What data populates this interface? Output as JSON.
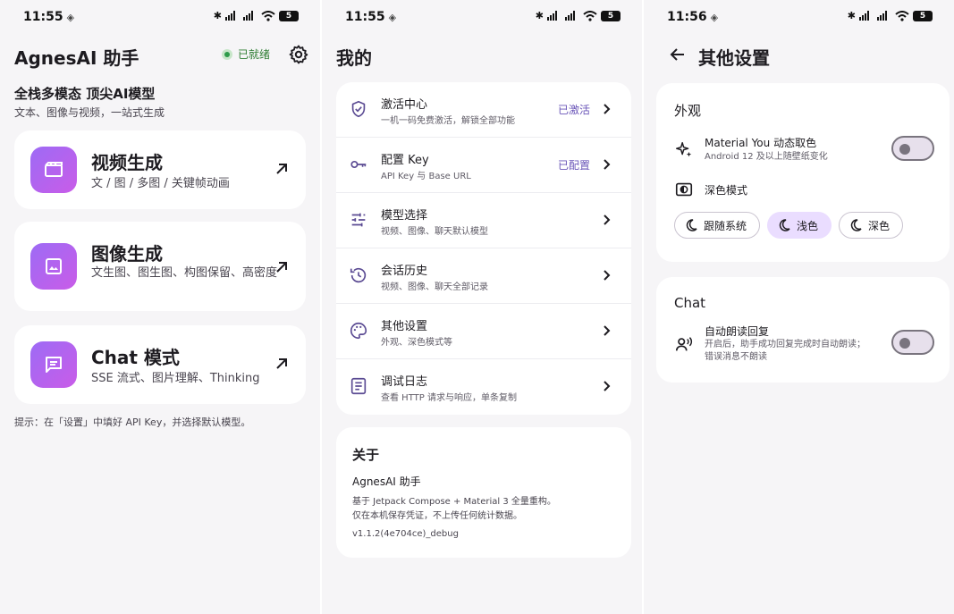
{
  "status_bars": [
    {
      "time": "11:55",
      "battery": "5"
    },
    {
      "time": "11:55",
      "battery": "5"
    },
    {
      "time": "11:56",
      "battery": "5"
    }
  ],
  "home": {
    "title": "AgnesAI 助手",
    "ready_label": "已就绪",
    "hero_title": "全栈多模态 顶尖AI模型",
    "hero_sub": "文本、图像与视频，一站式生成",
    "cards": [
      {
        "title": "视频生成",
        "sub": "文 / 图 / 多图 / 关键帧动画",
        "icon": "video-clapper-icon"
      },
      {
        "title": "图像生成",
        "sub": "文生图、图生图、构图保留、高密度",
        "icon": "image-icon"
      },
      {
        "title": "Chat 模式",
        "sub": "SSE 流式、图片理解、Thinking",
        "icon": "chat-icon"
      }
    ],
    "tip": "提示：在「设置」中填好 API Key，并选择默认模型。"
  },
  "mine": {
    "title": "我的",
    "items": [
      {
        "title": "激活中心",
        "sub": "一机一码免费激活，解锁全部功能",
        "status": "已激活",
        "icon": "shield-icon"
      },
      {
        "title": "配置 Key",
        "sub": "API Key 与 Base URL",
        "status": "已配置",
        "icon": "key-icon"
      },
      {
        "title": "模型选择",
        "sub": "视频、图像、聊天默认模型",
        "status": "",
        "icon": "tune-icon"
      },
      {
        "title": "会话历史",
        "sub": "视频、图像、聊天全部记录",
        "status": "",
        "icon": "history-icon"
      },
      {
        "title": "其他设置",
        "sub": "外观、深色模式等",
        "status": "",
        "icon": "palette-icon"
      },
      {
        "title": "调试日志",
        "sub": "查看 HTTP 请求与响应，单条复制",
        "status": "",
        "icon": "log-icon"
      }
    ],
    "about": {
      "title": "关于",
      "name": "AgnesAI 助手",
      "desc_line1": "基于 Jetpack Compose + Material 3 全量重构。",
      "desc_line2": "仅在本机保存凭证，不上传任何统计数据。",
      "version": "v1.1.2(4e704ce)_debug"
    }
  },
  "settings": {
    "title": "其他设置",
    "appearance": {
      "header": "外观",
      "dynamic_color_title": "Material You 动态取色",
      "dynamic_color_sub": "Android 12 及以上随壁纸变化",
      "dynamic_color_on": false,
      "dark_mode_title": "深色模式",
      "modes": [
        {
          "label": "跟随系统",
          "active": false
        },
        {
          "label": "浅色",
          "active": true
        },
        {
          "label": "深色",
          "active": false
        }
      ]
    },
    "chat": {
      "header": "Chat",
      "tts_title": "自动朗读回复",
      "tts_sub_line1": "开启后，助手成功回复完成时自动朗读；",
      "tts_sub_line2": "错误消息不朗读",
      "tts_on": false
    }
  },
  "colors": {
    "accent": "#6a55b8",
    "gradient_start": "#9d6bf5",
    "gradient_end": "#c95ce8",
    "ready_green": "#2e7d32",
    "active_segment": "#eaddff"
  }
}
